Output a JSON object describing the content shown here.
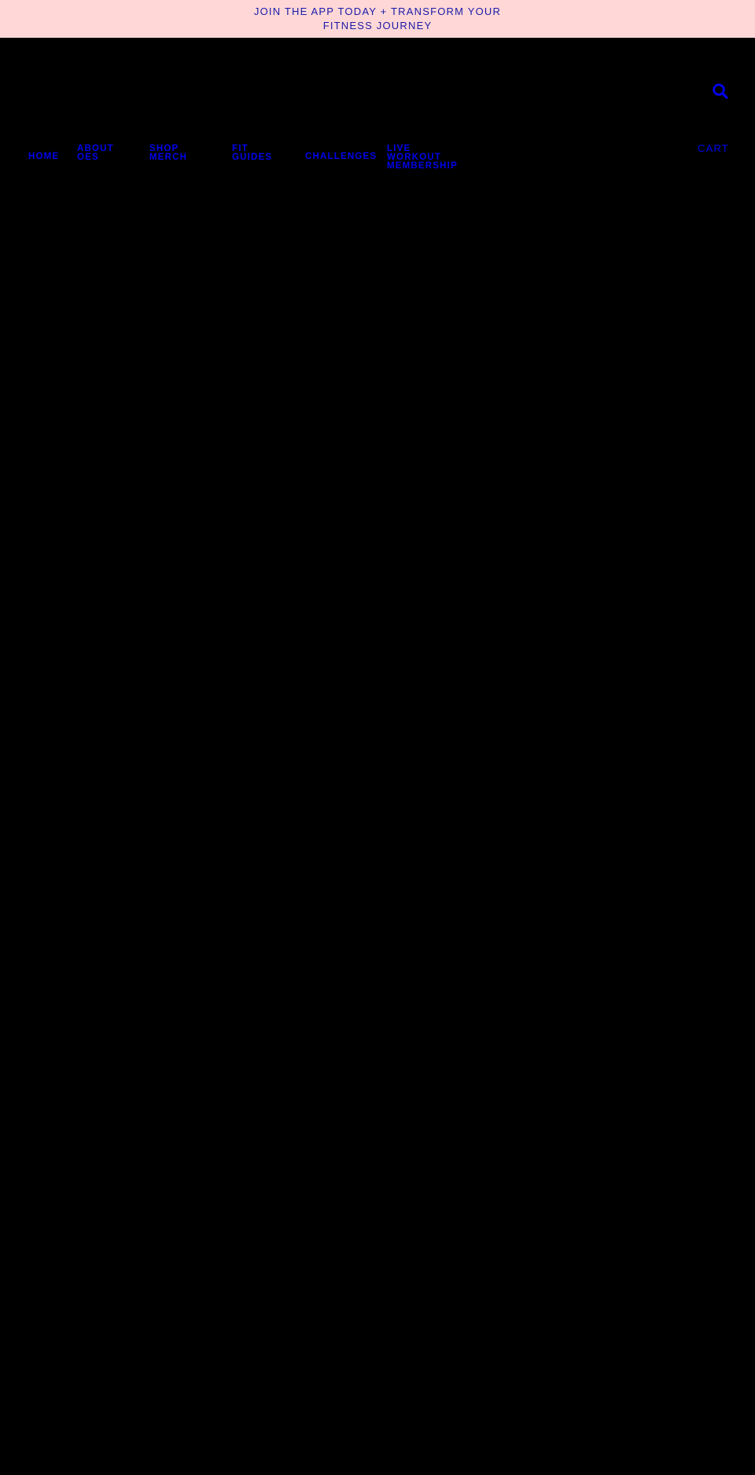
{
  "announcement": {
    "text": "JOIN THE APP TODAY + TRANSFORM YOUR FITNESS JOURNEY"
  },
  "colors": {
    "announcement_bg": "#ffd7d7",
    "announcement_text": "#1a1aa8",
    "link": "#0000ee",
    "page_bg": "#000000"
  },
  "header": {
    "search_icon": "search-icon",
    "cart_label": "CART"
  },
  "nav": {
    "home": "HOME",
    "about": "ABOUT OES",
    "shop": "SHOP MERCH",
    "guides": "FIT GUIDES",
    "challenges": "CHALLENGES",
    "live": "LIVE WORKOUT MEMBERSHIP"
  }
}
